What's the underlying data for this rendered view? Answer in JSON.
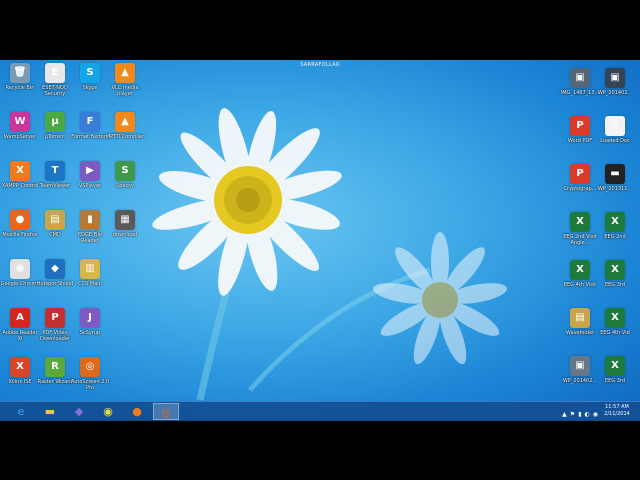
{
  "screen_title": "SARRAFOLLAR",
  "desktop": {
    "left": [
      {
        "label": "Recycle Bin",
        "glyph": "🗑",
        "color": "#7a9bb5",
        "col": 0,
        "row": 0
      },
      {
        "label": "ESET NOD Security",
        "glyph": "E",
        "color": "#e8e8e8",
        "col": 1,
        "row": 0
      },
      {
        "label": "Skype",
        "glyph": "S",
        "color": "#12a5e8",
        "col": 2,
        "row": 0
      },
      {
        "label": "VLC media player",
        "glyph": "▲",
        "color": "#f08a1c",
        "col": 3,
        "row": 0
      },
      {
        "label": "WampServer",
        "glyph": "W",
        "color": "#c9369b",
        "col": 0,
        "row": 1
      },
      {
        "label": "µTorrent",
        "glyph": "µ",
        "color": "#4ca843",
        "col": 1,
        "row": 1
      },
      {
        "label": "Format Factory",
        "glyph": "F",
        "color": "#3a7dd9",
        "col": 2,
        "row": 1
      },
      {
        "label": "MPTD Compiler",
        "glyph": "▲",
        "color": "#f08a1c",
        "col": 3,
        "row": 1
      },
      {
        "label": "XAMPP Control",
        "glyph": "X",
        "color": "#f07b1e",
        "col": 0,
        "row": 2
      },
      {
        "label": "TeamViewer",
        "glyph": "T",
        "color": "#1b76c5",
        "col": 1,
        "row": 2
      },
      {
        "label": "VSPlayer",
        "glyph": "▶",
        "color": "#7a5cc4",
        "col": 2,
        "row": 2
      },
      {
        "label": "Speccy",
        "glyph": "S",
        "color": "#3e9a4a",
        "col": 3,
        "row": 2
      },
      {
        "label": "Mozilla Firefox",
        "glyph": "●",
        "color": "#e8661b",
        "col": 0,
        "row": 3
      },
      {
        "label": "CMD",
        "glyph": "▤",
        "color": "#c4a84b",
        "col": 1,
        "row": 3
      },
      {
        "label": "EDGE File Reader",
        "glyph": "▮",
        "color": "#b37a3a",
        "col": 2,
        "row": 3
      },
      {
        "label": "download",
        "glyph": "▦",
        "color": "#5a5a5a",
        "col": 3,
        "row": 3
      },
      {
        "label": "Google Chrome",
        "glyph": "◉",
        "color": "#e0e0e0",
        "col": 0,
        "row": 4
      },
      {
        "label": "Hotspot Shield",
        "glyph": "◆",
        "color": "#1f6fbf",
        "col": 1,
        "row": 4
      },
      {
        "label": "CCS Main",
        "glyph": "▥",
        "color": "#d7b546",
        "col": 2,
        "row": 4
      },
      {
        "label": "Adobe Reader XI",
        "glyph": "A",
        "color": "#d4251e",
        "col": 0,
        "row": 5
      },
      {
        "label": "PDF Video Downloader",
        "glyph": "P",
        "color": "#c52f2f",
        "col": 1,
        "row": 5
      },
      {
        "label": "ScSyrup",
        "glyph": "J",
        "color": "#7d5ac4",
        "col": 2,
        "row": 5
      },
      {
        "label": "Xilinx ISE",
        "glyph": "X",
        "color": "#d9452b",
        "col": 0,
        "row": 6
      },
      {
        "label": "Raster Wizard",
        "glyph": "R",
        "color": "#5ba83c",
        "col": 1,
        "row": 6
      },
      {
        "label": "AutoScreen 2.0 Pro",
        "glyph": "◎",
        "color": "#d96a1e",
        "col": 2,
        "row": 6
      }
    ],
    "right": [
      {
        "label": "IMG_1487_13...",
        "glyph": "▣",
        "color": "#556677",
        "col": 0,
        "row": 0
      },
      {
        "label": "WP_201402...",
        "glyph": "▣",
        "color": "#334455",
        "col": 1,
        "row": 0
      },
      {
        "label": "Word PDF",
        "glyph": "P",
        "color": "#d83b2b",
        "col": 0,
        "row": 1
      },
      {
        "label": "Loaded Doc",
        "glyph": "▯",
        "color": "#f3f3f3",
        "col": 1,
        "row": 1
      },
      {
        "label": "Cryptograp...",
        "glyph": "P",
        "color": "#d83b2b",
        "col": 0,
        "row": 2
      },
      {
        "label": "WP_201311...",
        "glyph": "▬",
        "color": "#222222",
        "col": 1,
        "row": 2
      },
      {
        "label": "EEG 2nd Visit Angle...",
        "glyph": "X",
        "color": "#1e7a3c",
        "col": 0,
        "row": 3
      },
      {
        "label": "EEG 2nd",
        "glyph": "X",
        "color": "#1e7a3c",
        "col": 1,
        "row": 3
      },
      {
        "label": "EEG 4th Visit",
        "glyph": "X",
        "color": "#1e7a3c",
        "col": 0,
        "row": 4
      },
      {
        "label": "EEG 3rd",
        "glyph": "X",
        "color": "#1e7a3c",
        "col": 1,
        "row": 4
      },
      {
        "label": "Wavefolder",
        "glyph": "▤",
        "color": "#c9a54a",
        "col": 0,
        "row": 5
      },
      {
        "label": "EEG 4th Vid",
        "glyph": "X",
        "color": "#1e7a3c",
        "col": 1,
        "row": 5
      },
      {
        "label": "WP_201402...",
        "glyph": "▣",
        "color": "#667788",
        "col": 0,
        "row": 6
      },
      {
        "label": "EEG 3rd",
        "glyph": "X",
        "color": "#1e7a3c",
        "col": 1,
        "row": 6
      }
    ]
  },
  "taskbar": {
    "pinned": [
      {
        "name": "internet-explorer-icon",
        "glyph": "e",
        "color": "#3aa0e8"
      },
      {
        "name": "file-explorer-icon",
        "glyph": "▬",
        "color": "#f0c648"
      },
      {
        "name": "visual-studio-icon",
        "glyph": "◆",
        "color": "#8a6fd6"
      },
      {
        "name": "chrome-icon",
        "glyph": "◉",
        "color": "#e8e040"
      },
      {
        "name": "firefox-icon",
        "glyph": "●",
        "color": "#f07a1e"
      },
      {
        "name": "autoscreen-icon",
        "glyph": "◎",
        "color": "#e86a1e"
      }
    ],
    "active_index": 5,
    "tray": [
      "▲",
      "⚑",
      "▮",
      "◐",
      "◉"
    ],
    "time": "11:57 AM",
    "date": "2/11/2014"
  }
}
